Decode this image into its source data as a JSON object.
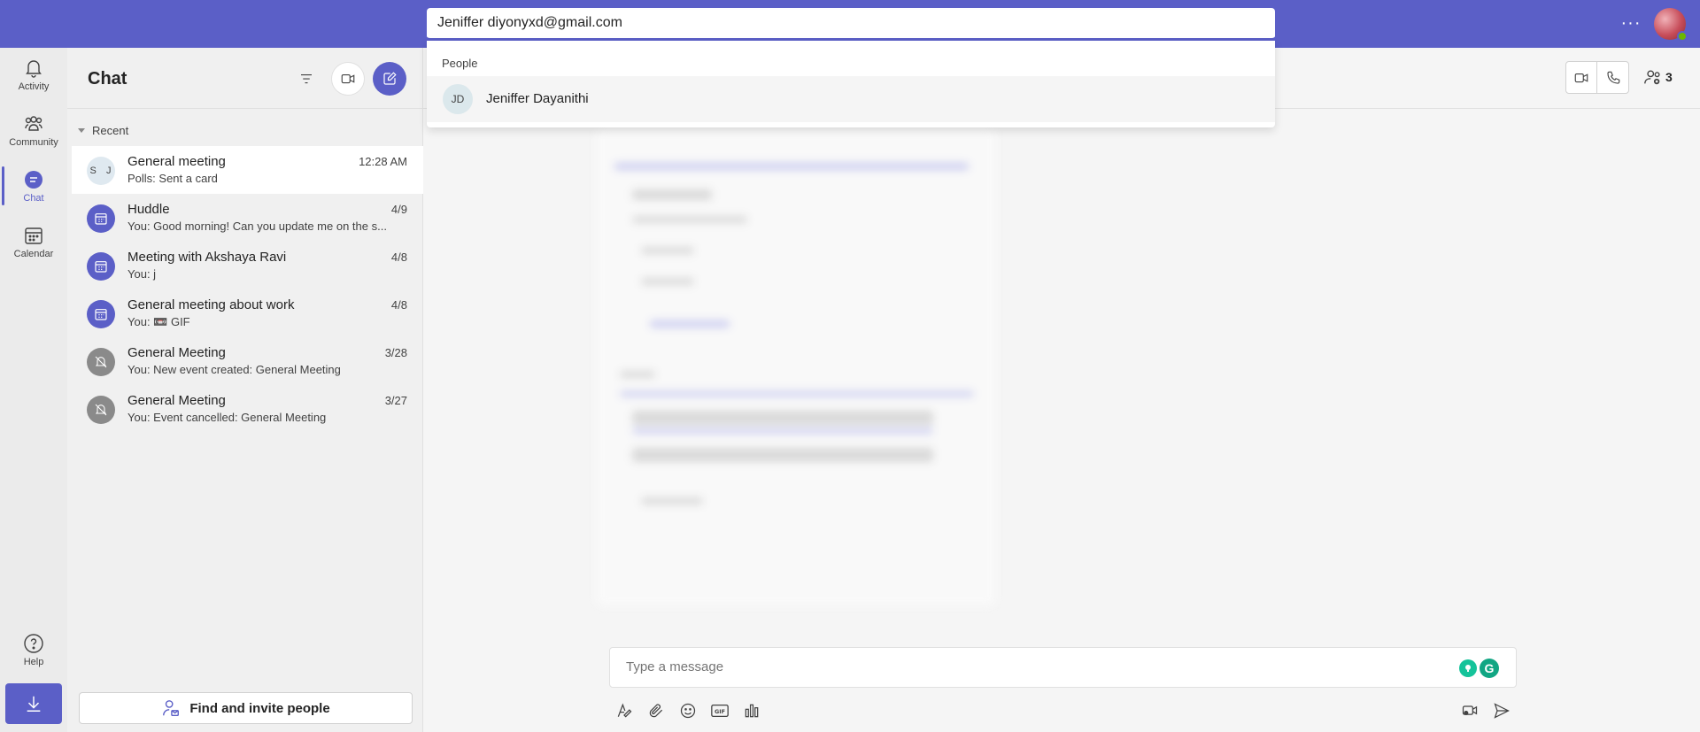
{
  "search": {
    "value": "Jeniffer diyonyxd@gmail.com"
  },
  "dropdown": {
    "section_label": "People",
    "results": [
      {
        "initials": "JD",
        "name": "Jeniffer Dayanithi"
      }
    ]
  },
  "rail": {
    "items": [
      {
        "label": "Activity",
        "icon": "bell-icon"
      },
      {
        "label": "Community",
        "icon": "community-icon"
      },
      {
        "label": "Chat",
        "icon": "chat-icon",
        "active": true
      },
      {
        "label": "Calendar",
        "icon": "calendar-icon"
      },
      {
        "label": "Help",
        "icon": "help-icon"
      }
    ]
  },
  "chat_pane": {
    "title": "Chat",
    "section": "Recent",
    "invite_label": "Find and invite people",
    "items": [
      {
        "name": "General meeting",
        "preview": "Polls: Sent a card",
        "time": "12:28 AM",
        "avatar": "S J",
        "type": "group"
      },
      {
        "name": "Huddle",
        "preview": "You: Good morning! Can you update me on the s...",
        "time": "4/9",
        "type": "meeting"
      },
      {
        "name": "Meeting with Akshaya Ravi",
        "preview": "You: j",
        "time": "4/8",
        "type": "meeting"
      },
      {
        "name": "General meeting about work",
        "preview": "You: 📼 GIF",
        "time": "4/8",
        "type": "meeting"
      },
      {
        "name": "General Meeting",
        "preview": "You: New event created: General Meeting",
        "time": "3/28",
        "type": "cancelled"
      },
      {
        "name": "General Meeting",
        "preview": "You: Event cancelled: General Meeting",
        "time": "3/27",
        "type": "cancelled"
      }
    ]
  },
  "main": {
    "participants_count": "3",
    "composer_placeholder": "Type a message"
  },
  "colors": {
    "brand": "#5b5fc7",
    "rail": "#ebebeb",
    "pane": "#f0f0f0"
  }
}
